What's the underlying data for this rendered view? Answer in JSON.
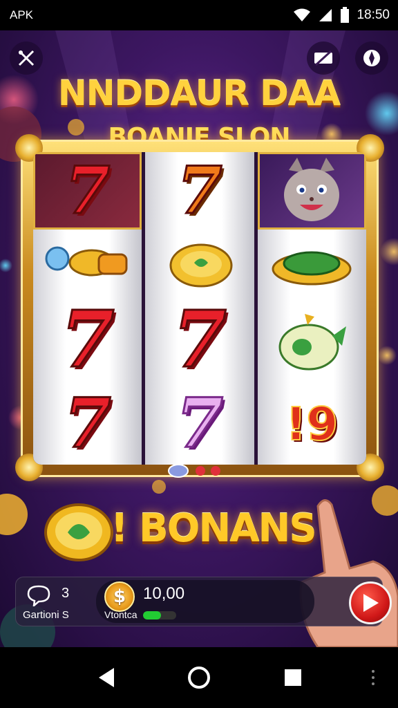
{
  "status_bar": {
    "app_label": "APK",
    "time": "18:50",
    "icons": [
      "wifi-icon",
      "signal-icon",
      "battery-icon"
    ]
  },
  "top_controls": {
    "left_icon": "tools-icon",
    "right_icons": [
      "screen-icon",
      "compass-icon"
    ]
  },
  "title": {
    "line1": "NNDDAUR DAA",
    "line2": "BOANIE SLON"
  },
  "reels": [
    [
      "seven-red",
      "coin-bullet",
      "seven-red",
      "seven-red"
    ],
    [
      "seven-orange",
      "gold-coin",
      "seven-red",
      "seven-pink"
    ],
    [
      "cat-face",
      "green-leaf-plate",
      "green-fruit",
      "red-coin"
    ]
  ],
  "bonus": {
    "text": "! BONANS",
    "seven_glyph": "7",
    "coin_glyph": "!9"
  },
  "panel": {
    "chat_count": "3",
    "chat_label": "Gartioni S",
    "coin_symbol": "$",
    "balance_value": "10,00",
    "balance_label": "Vtontca",
    "progress_fraction": 0.55
  },
  "colors": {
    "background": "#3d1762",
    "gold": "#ffd23e",
    "play_red": "#d01818",
    "progress_green": "#22cc33"
  },
  "nav": [
    "back-icon",
    "home-icon",
    "recents-icon"
  ]
}
